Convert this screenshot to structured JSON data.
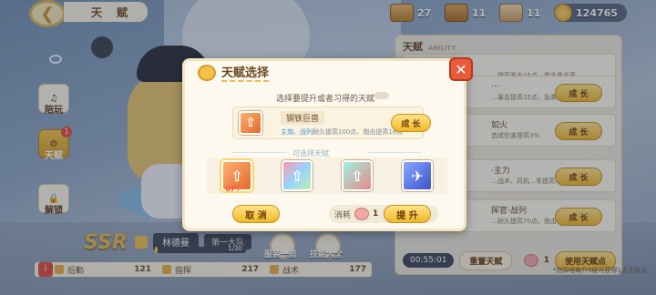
{
  "header": {
    "title": "天 赋",
    "back_icon": "back-arrow-icon"
  },
  "resources": [
    {
      "icon": "cardboard-box-icon",
      "value": "27"
    },
    {
      "icon": "cardboard-box-icon",
      "value": "11"
    },
    {
      "icon": "cake-box-icon",
      "value": "11"
    },
    {
      "icon": "coin-icon",
      "value": "124765"
    }
  ],
  "sidebar": {
    "items": [
      {
        "label": "陪玩",
        "icon": "microphone-icon",
        "active": false
      },
      {
        "label": "天赋",
        "icon": "gear-icon",
        "active": true,
        "badge": "1"
      },
      {
        "label": "解锁",
        "icon": "lock-icon",
        "active": false
      }
    ]
  },
  "character": {
    "rarity": "SSR",
    "name": "林德曼",
    "rank": "第一大队",
    "level_text": "1/30",
    "level_progress": 0.03,
    "buttons": [
      {
        "label": "服装一览"
      },
      {
        "label": "技能大全"
      }
    ]
  },
  "stats": [
    {
      "label": "后勤",
      "value": "121"
    },
    {
      "label": "指挥",
      "value": "217"
    },
    {
      "label": "战术",
      "value": "177"
    }
  ],
  "ability_panel": {
    "title": "天赋",
    "subtitle": "ABILITY",
    "rows": [
      {
        "title": "…",
        "desc": "…提高暴击15点，首击暴击率…",
        "button": "成 长"
      },
      {
        "title": "…",
        "desc": "…暴击提高15点，急袭暴击率…",
        "button": "成 长"
      },
      {
        "title": "如火",
        "desc": "造成伤害提高3%",
        "button": "成 长"
      },
      {
        "title": "·主力",
        "desc": "…战术、风机…率提高…",
        "button": "成 长"
      },
      {
        "title": "挥官·战列",
        "desc": "…耐久提高70点、炮击…",
        "button": "成 长"
      }
    ],
    "timer": "00:55:01",
    "reset_label": "重置天赋",
    "cost_count": "1",
    "use_label": "使用天赋点",
    "note": "*指挥喵每升5级可获得1点天赋点"
  },
  "modal": {
    "title": "天赋选择",
    "hint": "选择要提升或者习得的天赋",
    "selected": {
      "name": "钢铁巨兽",
      "desc_prefix": "主炮、战列",
      "desc_rest": "耐久提高100点、炮击提高16点",
      "button": "成 长"
    },
    "available_title": "可选择天赋",
    "choices": [
      {
        "icon": "upgrade-arrow-icon",
        "tag": "UP!"
      },
      {
        "icon": "rainbow-upgrade-icon",
        "tag": ""
      },
      {
        "icon": "teal-upgrade-icon",
        "tag": ""
      },
      {
        "icon": "airplane-icon",
        "tag": ""
      }
    ],
    "cancel_label": "取 消",
    "cost_label": "消耗",
    "cost_value": "1",
    "upgrade_label": "提 升"
  }
}
